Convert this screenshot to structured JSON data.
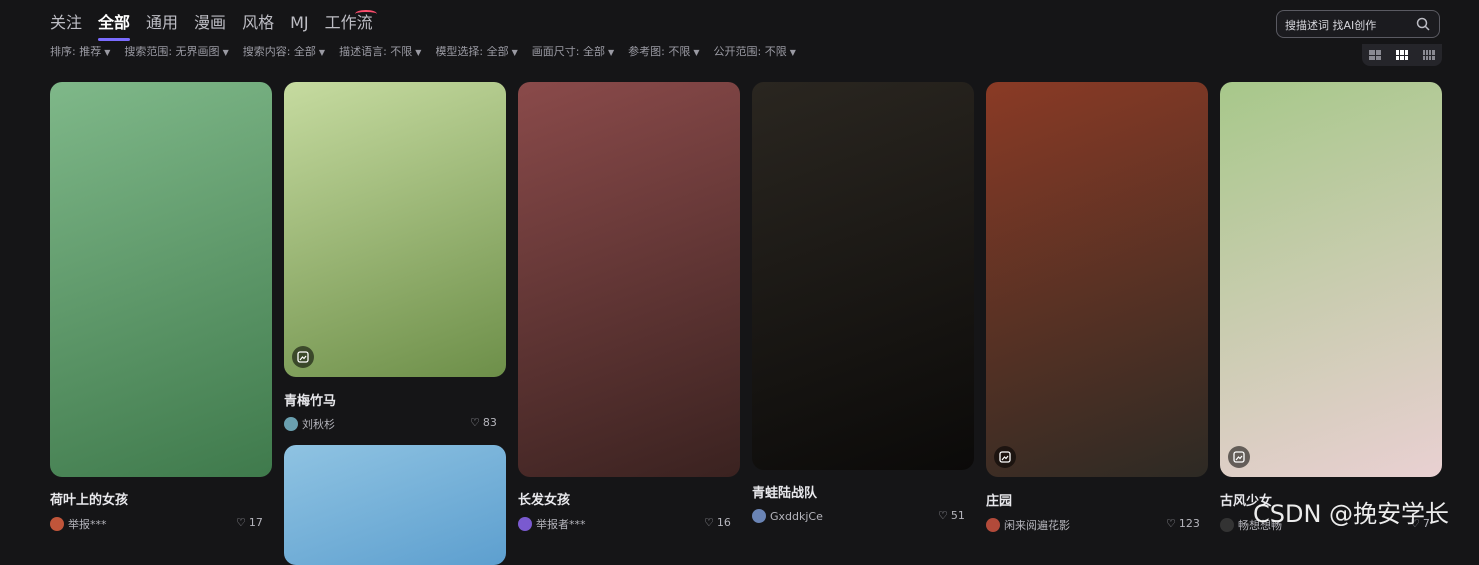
{
  "tabs": [
    {
      "label": "关注",
      "active": false
    },
    {
      "label": "全部",
      "active": true
    },
    {
      "label": "通用",
      "active": false
    },
    {
      "label": "漫画",
      "active": false
    },
    {
      "label": "风格",
      "active": false
    },
    {
      "label": "MJ",
      "active": false
    },
    {
      "label": "工作流",
      "active": false
    }
  ],
  "search": {
    "placeholder": "搜描述词 找AI创作"
  },
  "filters": [
    {
      "label": "排序: 推荐"
    },
    {
      "label": "搜索范围: 无界画图"
    },
    {
      "label": "搜索内容: 全部"
    },
    {
      "label": "描述语言: 不限"
    },
    {
      "label": "模型选择: 全部"
    },
    {
      "label": "画面尺寸: 全部"
    },
    {
      "label": "参考图: 不限"
    },
    {
      "label": "公开范围: 不限"
    }
  ],
  "cards": [
    {
      "title": "荷叶上的女孩",
      "author": "举报***",
      "likes": "17",
      "colors": [
        "#7fb889",
        "#3f7a4c"
      ],
      "avatar": "#c0553a"
    },
    {
      "title": "青梅竹马",
      "author": "刘秋杉",
      "likes": "83",
      "colors": [
        "#c6dba0",
        "#6d8f49"
      ],
      "avatar": "#6aa0b0"
    },
    {
      "title": "",
      "author": "",
      "likes": "",
      "colors": [
        "#8fc3e2",
        "#5d9fcf"
      ],
      "avatar": "#888"
    },
    {
      "title": "长发女孩",
      "author": "举报者***",
      "likes": "16",
      "colors": [
        "#8a4a4a",
        "#3a2220"
      ],
      "avatar": "#7a5acf"
    },
    {
      "title": "青蛙陆战队",
      "author": "GxddkjCe",
      "likes": "51",
      "colors": [
        "#2a2620",
        "#0b0a09"
      ],
      "avatar": "#6a84b5"
    },
    {
      "title": "庄园",
      "author": "闲来阅遍花影",
      "likes": "123",
      "colors": [
        "#8a3a25",
        "#2d2a24"
      ],
      "avatar": "#b24a3a"
    },
    {
      "title": "古风少女",
      "author": "畅想想畅",
      "likes": "7",
      "colors": [
        "#a7c88a",
        "#e9d0d2"
      ],
      "avatar": "#333"
    }
  ],
  "watermark": "CSDN @挽安学长"
}
